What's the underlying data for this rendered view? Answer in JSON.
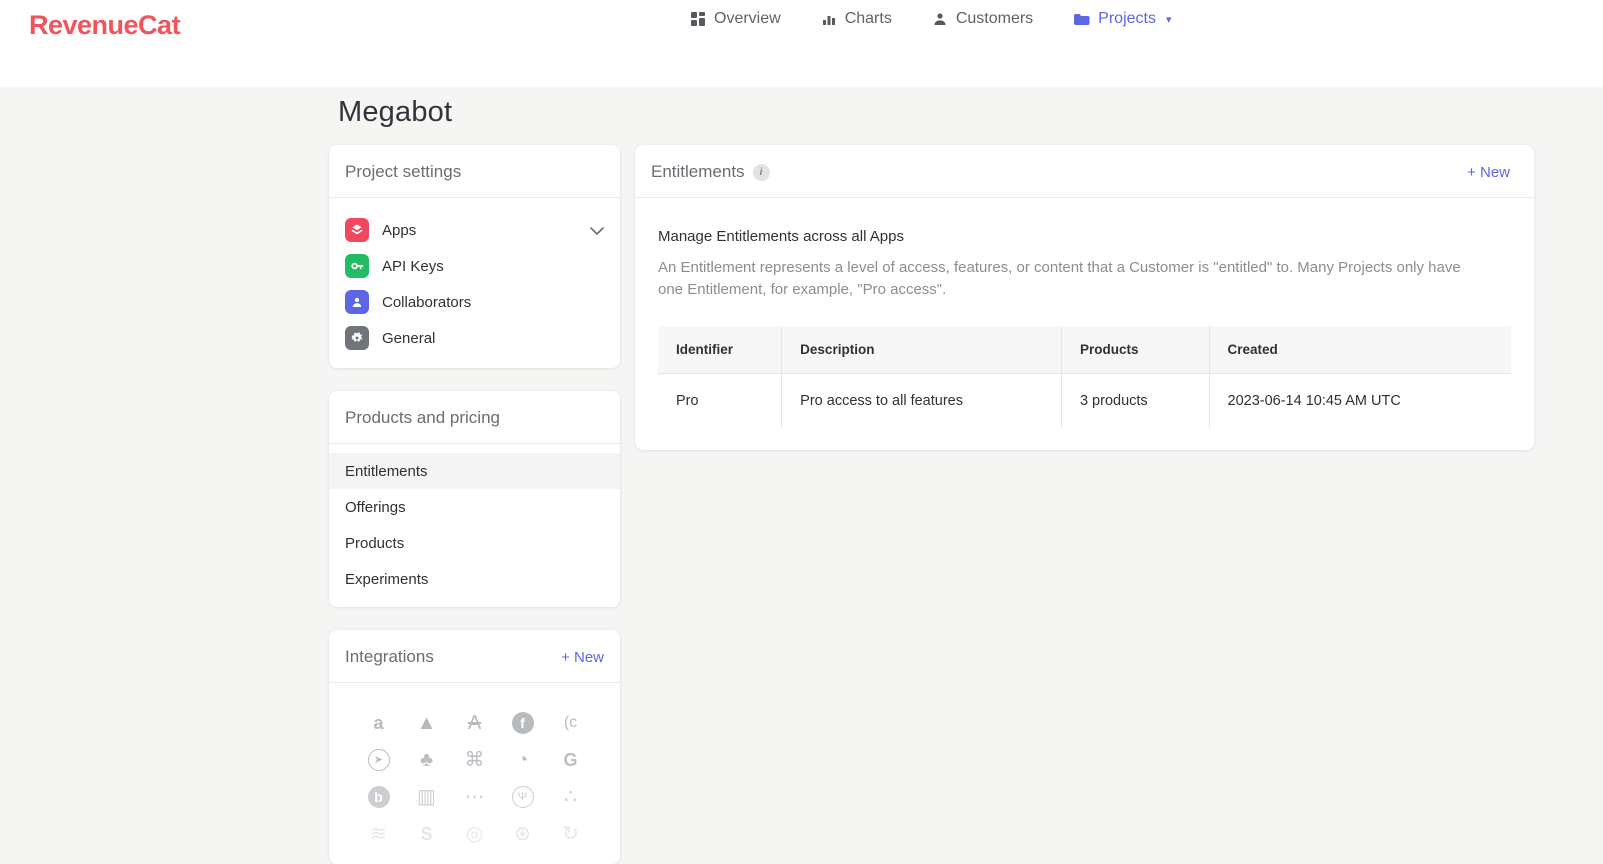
{
  "colors": {
    "brand": "#F2545B",
    "accent": "#5B67E5",
    "page_bg": "#F5F5F4",
    "apps_icon_bg": "#F0485C",
    "api_keys_icon_bg": "#23BB63",
    "collaborators_icon_bg": "#5B67E5",
    "general_icon_bg": "#71747B"
  },
  "brand": {
    "logo_text": "RevenueCat"
  },
  "nav": {
    "caret": "▾",
    "items": [
      {
        "label": "Overview",
        "icon": "grid-icon",
        "active": false
      },
      {
        "label": "Charts",
        "icon": "bar-chart-icon",
        "active": false
      },
      {
        "label": "Customers",
        "icon": "person-icon",
        "active": false
      },
      {
        "label": "Projects",
        "icon": "folder-icon",
        "active": true
      }
    ]
  },
  "page": {
    "title": "Megabot"
  },
  "project_settings": {
    "title": "Project settings",
    "items": [
      {
        "label": "Apps"
      },
      {
        "label": "API Keys"
      },
      {
        "label": "Collaborators"
      },
      {
        "label": "General"
      }
    ]
  },
  "products_pricing": {
    "title": "Products and pricing",
    "items": [
      {
        "label": "Entitlements",
        "selected": true
      },
      {
        "label": "Offerings",
        "selected": false
      },
      {
        "label": "Products",
        "selected": false
      },
      {
        "label": "Experiments",
        "selected": false
      }
    ]
  },
  "integrations": {
    "title": "Integrations",
    "new_label": "+ New",
    "icons": [
      {
        "name": "integration-icon-amazon",
        "glyph": "a"
      },
      {
        "name": "integration-icon-airship",
        "glyph": "▲"
      },
      {
        "name": "integration-icon-adjust",
        "glyph": "A"
      },
      {
        "name": "integration-icon-facebook",
        "glyph": "f"
      },
      {
        "name": "integration-icon-clevertap",
        "glyph": "(c"
      },
      {
        "name": "integration-icon-appsflyer",
        "glyph": "➤"
      },
      {
        "name": "integration-icon-mparticle",
        "glyph": "♣"
      },
      {
        "name": "integration-icon-apple",
        "glyph": "⌘"
      },
      {
        "name": "integration-icon-onesignal",
        "glyph": "◔"
      },
      {
        "name": "integration-icon-google",
        "glyph": "G"
      },
      {
        "name": "integration-icon-braze",
        "glyph": "b"
      },
      {
        "name": "integration-icon-intercom",
        "glyph": "▥"
      },
      {
        "name": "integration-icon-more-dots",
        "glyph": "⋯"
      },
      {
        "name": "integration-icon-branch",
        "glyph": "Ψ"
      },
      {
        "name": "integration-icon-molecule",
        "glyph": "∴"
      },
      {
        "name": "integration-icon-waves",
        "glyph": "≋"
      },
      {
        "name": "integration-icon-segment",
        "glyph": "S"
      },
      {
        "name": "integration-icon-target",
        "glyph": "◎"
      },
      {
        "name": "integration-icon-spiral",
        "glyph": "⊛"
      },
      {
        "name": "integration-icon-refresh",
        "glyph": "↻"
      }
    ]
  },
  "entitlements_panel": {
    "title": "Entitlements",
    "info_glyph": "i",
    "new_label": "+ New",
    "subtitle": "Manage Entitlements across all Apps",
    "description": "An Entitlement represents a level of access, features, or content that a Customer is \"entitled\" to. Many Projects only have one Entitlement, for example, \"Pro access\".",
    "table": {
      "headers": [
        "Identifier",
        "Description",
        "Products",
        "Created"
      ],
      "rows": [
        {
          "identifier": "Pro",
          "description": "Pro access to all features",
          "products": "3 products",
          "created": "2023-06-14 10:45 AM UTC"
        }
      ]
    }
  }
}
